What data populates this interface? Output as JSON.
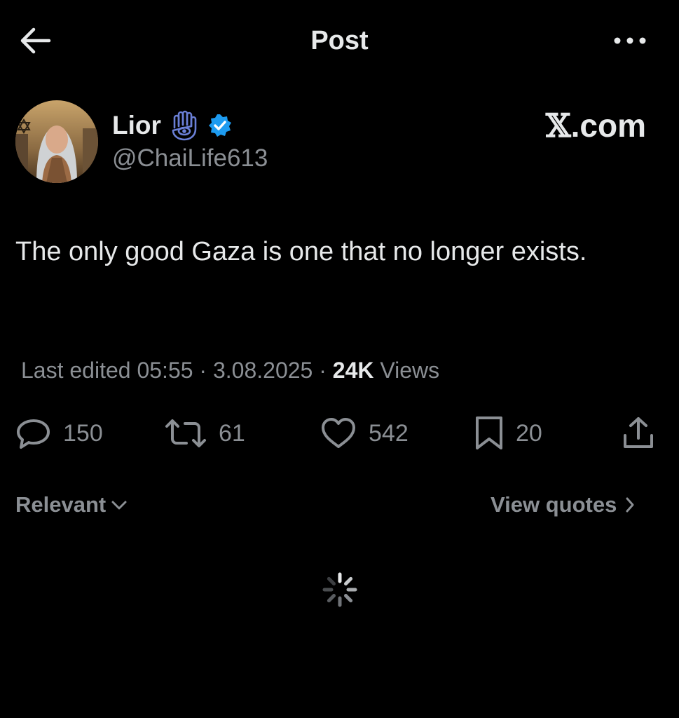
{
  "header": {
    "title": "Post",
    "back_icon": "arrow-left-icon",
    "more_icon": "more-horizontal-icon"
  },
  "post": {
    "author": {
      "display_name": "Lior",
      "handle": "@ChaiLife613",
      "emoji_icon": "hamsa-icon",
      "verified_icon": "verified-badge-icon",
      "verified_color": "#1d9bf0"
    },
    "watermark": {
      "x_mark": "𝕏",
      "suffix": ".com"
    },
    "text": "The only good Gaza is one that no longer exists.",
    "meta": {
      "edited_prefix": "Last edited 05:55 · 3.08.2025",
      "separator": " · ",
      "views_count": "24K",
      "views_label": "Views"
    },
    "actions": {
      "replies": "150",
      "reposts": "61",
      "likes": "542",
      "bookmarks": "20"
    }
  },
  "replies_bar": {
    "sort_label": "Relevant",
    "view_quotes_label": "View quotes"
  },
  "colors": {
    "background": "#000000",
    "text": "#e7e9ea",
    "muted": "#8b8f94",
    "accent": "#1d9bf0"
  }
}
